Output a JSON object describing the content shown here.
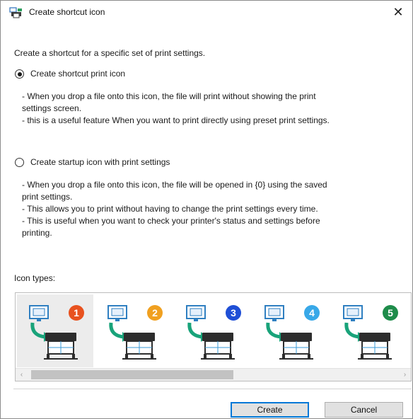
{
  "dialog": {
    "title": "Create shortcut icon",
    "close_glyph": "✕",
    "intro": "Create a shortcut for a specific set of print settings.",
    "options": [
      {
        "label": "Create shortcut print icon",
        "checked": true,
        "description": [
          "- When you drop a file onto this icon, the file will print without showing the print",
          "settings screen.",
          "- this is a useful feature When you want to print directly using preset print settings."
        ]
      },
      {
        "label": "Create startup icon with print settings",
        "checked": false,
        "description": [
          "- When you drop a file onto this icon, the file will be opened in {0} using the saved",
          "print settings.",
          "- This allows you to print without having to change the print settings every time.",
          "- This is useful when you want to check your printer's status and settings before",
          "printing."
        ]
      }
    ],
    "icon_types_label": "Icon types:",
    "icon_types": [
      {
        "number": "1",
        "color": "#e8521f",
        "icon": "printer-shortcut-icon-1"
      },
      {
        "number": "2",
        "color": "#f0a020",
        "icon": "printer-shortcut-icon-2"
      },
      {
        "number": "3",
        "color": "#1f4fd6",
        "icon": "printer-shortcut-icon-3"
      },
      {
        "number": "4",
        "color": "#38a8e8",
        "icon": "printer-shortcut-icon-4"
      },
      {
        "number": "5",
        "color": "#1e8c4a",
        "icon": "printer-shortcut-icon-5"
      }
    ],
    "selected_icon_index": 0,
    "scrollbar": {
      "left_arrow": "‹",
      "right_arrow": "›"
    },
    "buttons": {
      "create": "Create",
      "cancel": "Cancel"
    }
  }
}
